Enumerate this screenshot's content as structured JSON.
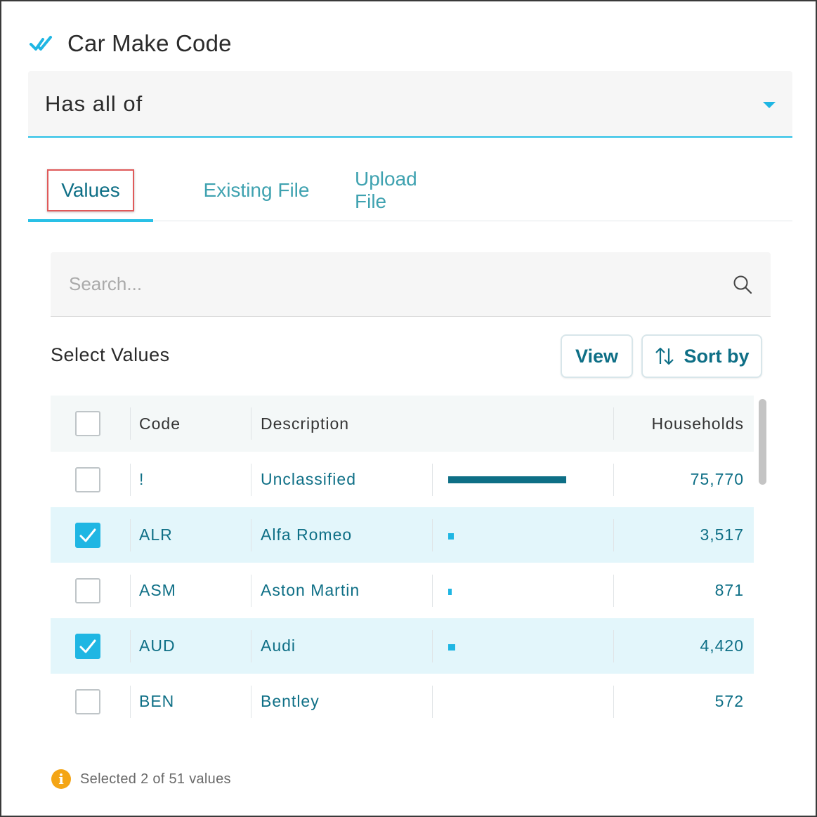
{
  "header": {
    "title": "Car Make Code",
    "icon": "double-check-icon"
  },
  "filter": {
    "selected": "Has all of"
  },
  "tabs": [
    {
      "label": "Values",
      "active": true
    },
    {
      "label": "Existing File",
      "active": false
    },
    {
      "label": "Upload File",
      "active": false
    }
  ],
  "search": {
    "placeholder": "Search...",
    "value": ""
  },
  "select_values": {
    "label": "Select Values",
    "view_label": "View",
    "sort_label": "Sort by"
  },
  "table": {
    "columns": [
      "Code",
      "Description",
      "Households"
    ],
    "rows": [
      {
        "code": "!",
        "description": "Unclassified",
        "households": "75,770",
        "checked": false,
        "bar_fraction": 1.0
      },
      {
        "code": "ALR",
        "description": "Alfa Romeo",
        "households": "3,517",
        "checked": true,
        "bar_fraction": 0.046
      },
      {
        "code": "ASM",
        "description": "Aston Martin",
        "households": "871",
        "checked": false,
        "bar_fraction": 0.011
      },
      {
        "code": "AUD",
        "description": "Audi",
        "households": "4,420",
        "checked": true,
        "bar_fraction": 0.058
      },
      {
        "code": "BEN",
        "description": "Bentley",
        "households": "572",
        "checked": false,
        "bar_fraction": 0.0075
      }
    ]
  },
  "footer": {
    "text": "Selected 2 of 51 values"
  },
  "colors": {
    "accent": "#29c0e6",
    "teal": "#0e6f86",
    "warning": "#f4a515",
    "highlight_box": "#e05a5a"
  }
}
